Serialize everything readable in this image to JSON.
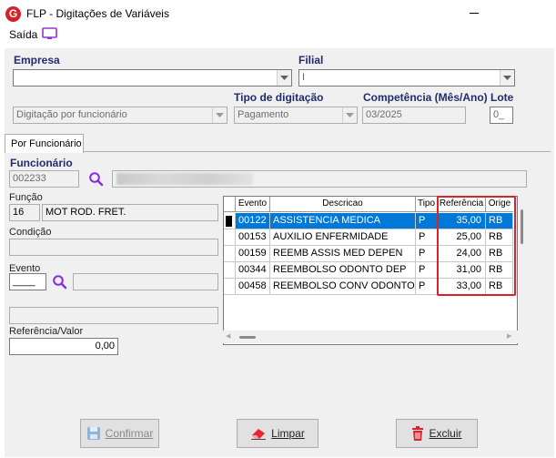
{
  "window": {
    "title": "FLP - Digitações de Variáveis",
    "app_icon_letter": "G"
  },
  "menu": {
    "saida": "Saída"
  },
  "empresa": {
    "label": "Empresa",
    "value": ""
  },
  "filial": {
    "label": "Filial",
    "value": "I"
  },
  "digitacao_mode": {
    "value": "Digitação por funcionário"
  },
  "tipo_digitacao": {
    "label": "Tipo de digitação",
    "value": "Pagamento"
  },
  "competencia": {
    "label": "Competência (Mês/Ano)",
    "value": "03/2025"
  },
  "lote": {
    "label": "Lote",
    "value": "0_"
  },
  "tabs": [
    {
      "label": "Por Funcionário"
    }
  ],
  "funcionario": {
    "label": "Funcionário",
    "code": "002233",
    "name": ""
  },
  "funcao": {
    "label": "Função",
    "code": "16",
    "description": "MOT ROD. FRET."
  },
  "condicao": {
    "label": "Condição",
    "value": ""
  },
  "evento": {
    "label": "Evento",
    "code": "____",
    "description": ""
  },
  "extra_field": {
    "value": ""
  },
  "referencia_valor": {
    "label": "Referência/Valor",
    "value": "0,00"
  },
  "grid": {
    "columns": [
      "Evento",
      "Descricao",
      "Tipo",
      "Referência",
      "Orige"
    ],
    "rows": [
      {
        "evento": "00122",
        "descricao": "ASSISTENCIA MEDICA",
        "tipo": "P",
        "referencia": "35,00",
        "origem": "RB",
        "selected": true
      },
      {
        "evento": "00153",
        "descricao": "AUXILIO ENFERMIDADE",
        "tipo": "P",
        "referencia": "25,00",
        "origem": "RB",
        "selected": false
      },
      {
        "evento": "00159",
        "descricao": "REEMB ASSIS MED DEPEN",
        "tipo": "P",
        "referencia": "24,00",
        "origem": "RB",
        "selected": false
      },
      {
        "evento": "00344",
        "descricao": "REEMBOLSO ODONTO DEP",
        "tipo": "P",
        "referencia": "31,00",
        "origem": "RB",
        "selected": false
      },
      {
        "evento": "00458",
        "descricao": "REEMBOLSO CONV ODONTO",
        "tipo": "P",
        "referencia": "33,00",
        "origem": "RB",
        "selected": false
      }
    ]
  },
  "buttons": {
    "confirmar": "Confirmar",
    "limpar": "Limpar",
    "excluir": "Excluir"
  },
  "colors": {
    "label_blue": "#1f2d6e",
    "selection": "#0078d7",
    "highlight_red": "#d9222a",
    "search_purple": "#8a2be2"
  }
}
